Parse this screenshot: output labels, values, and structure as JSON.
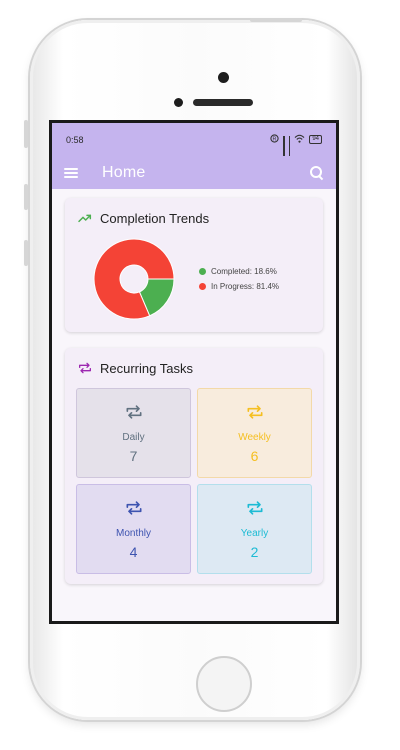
{
  "status_bar": {
    "time": "0:58",
    "battery": "94"
  },
  "app_bar": {
    "title": "Home"
  },
  "completion_trends": {
    "title": "Completion Trends",
    "legend": [
      {
        "label": "Completed: 18.6%",
        "color": "#4caf50"
      },
      {
        "label": "In Progress: 81.4%",
        "color": "#f44336"
      }
    ]
  },
  "chart_data": {
    "type": "pie",
    "categories": [
      "Completed",
      "In Progress"
    ],
    "values": [
      18.6,
      81.4
    ],
    "colors": [
      "#4caf50",
      "#f44336"
    ],
    "title": "",
    "legend_position": "right"
  },
  "recurring_tasks": {
    "title": "Recurring Tasks",
    "tiles": [
      {
        "label": "Daily",
        "count": "7",
        "color": "#617180",
        "bg": "#e5e1ea",
        "border": "#cfc6dc"
      },
      {
        "label": "Weekly",
        "count": "6",
        "color": "#f5bf21",
        "bg": "#f8ecdd",
        "border": "#f3d9a8"
      },
      {
        "label": "Monthly",
        "count": "4",
        "color": "#3e54b0",
        "bg": "#e2dcf1",
        "border": "#c9bde6"
      },
      {
        "label": "Yearly",
        "count": "2",
        "color": "#1dbbd4",
        "bg": "#dde9f3",
        "border": "#b3dfec"
      }
    ]
  },
  "icons": {
    "menu": "menu-icon",
    "search": "search-icon",
    "trend": "trending-up-icon",
    "repeat": "repeat-icon"
  }
}
